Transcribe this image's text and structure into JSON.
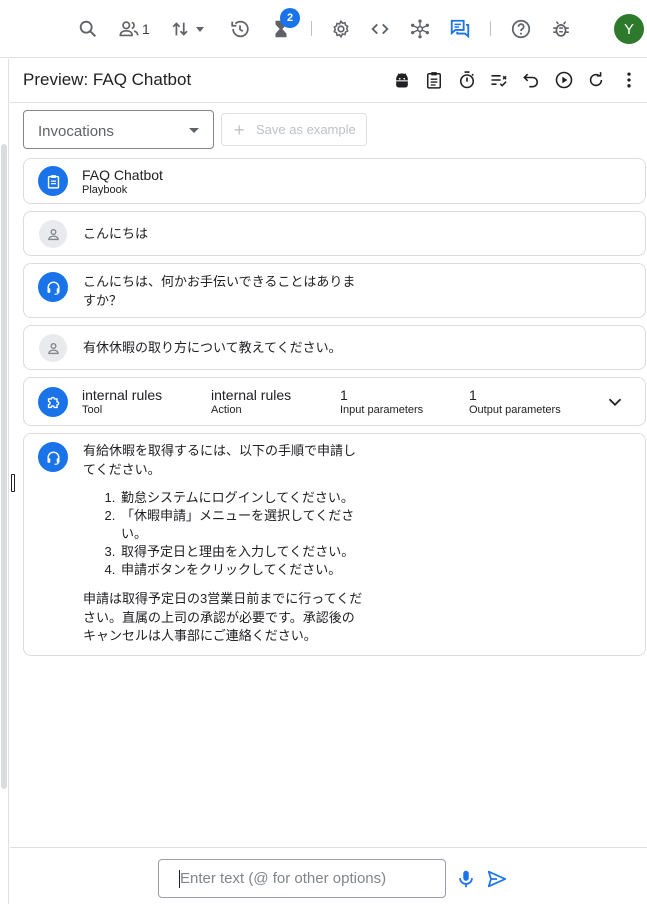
{
  "toolbar": {
    "agents_count": "1",
    "notifications_badge": "2",
    "avatar_initial": "Y",
    "icons": [
      "search-icon",
      "people-icon",
      "sort-icon",
      "history-icon",
      "hourglass-icon",
      "settings-icon",
      "code-icon",
      "hub-icon",
      "chat-icon",
      "help-icon",
      "bug-icon"
    ]
  },
  "preview": {
    "title": "Preview: FAQ Chatbot",
    "actions": [
      "android-icon",
      "clipboard-icon",
      "timer-icon",
      "playlist-check-icon",
      "undo-icon",
      "play-icon",
      "refresh-icon",
      "more-vert-icon"
    ]
  },
  "controls": {
    "select_value": "Invocations",
    "save_label": "Save as example"
  },
  "conversation": {
    "playbook": {
      "title": "FAQ Chatbot",
      "subtitle": "Playbook"
    },
    "user1": "こんにちは",
    "agent1_line1": "こんにちは、何かお手伝いできることはありま",
    "agent1_line2": "すか？",
    "user2": "有休休暇の取り方について教えてください。",
    "tool": {
      "name": "internal rules",
      "name_label": "Tool",
      "action": "internal rules",
      "action_label": "Action",
      "inputs": "1",
      "inputs_label": "Input parameters",
      "outputs": "1",
      "outputs_label": "Output parameters"
    },
    "agent2": {
      "intro_line1": "有給休暇を取得するには、以下の手順で申請し",
      "intro_line2": "てください。",
      "steps": [
        "勤怠システムにログインしてください。",
        "「休暇申請」メニューを選択してくださ",
        "取得予定日と理由を入力してください。",
        "申請ボタンをクリックしてください。"
      ],
      "step2_cont": "い。",
      "outro_line1": "申請は取得予定日の3営業日前までに行ってくだ",
      "outro_line2": "さい。直属の上司の承認が必要です。承認後の",
      "outro_line3": "キャンセルは人事部にご連絡ください。"
    }
  },
  "composer": {
    "placeholder": "Enter text (@ for other options)"
  },
  "colors": {
    "accent": "#1a73e8",
    "avatar": "#2d7a2d"
  }
}
